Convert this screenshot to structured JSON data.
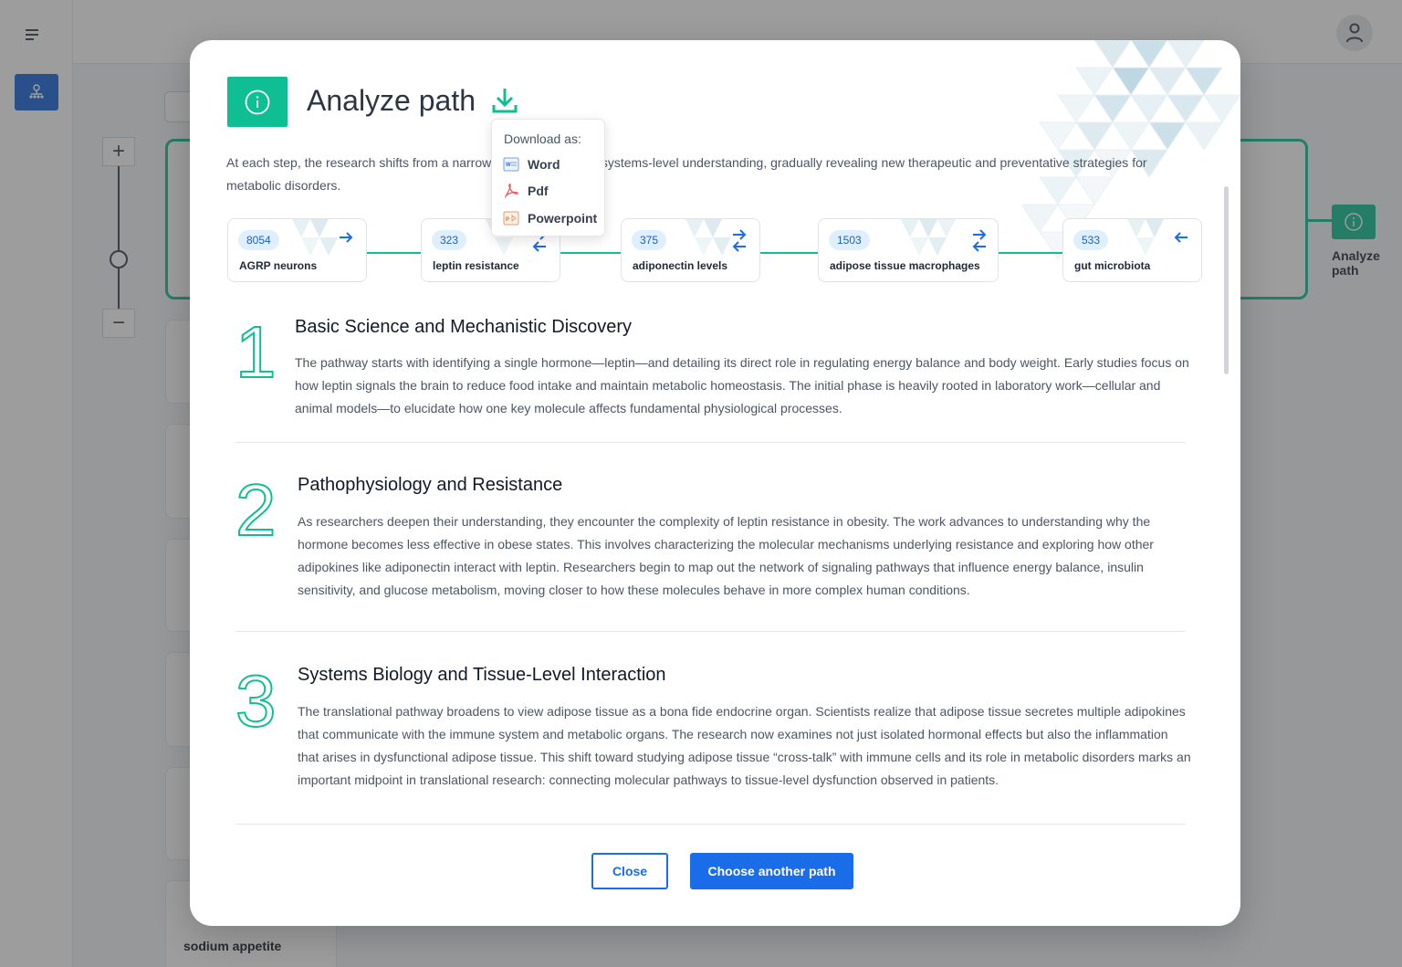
{
  "modal": {
    "title": "Analyze path",
    "intro": "At each step, the research shifts from a narrow focus to a broader systems-level understanding, gradually revealing new therapeutic and preventative strategies for metabolic disorders.",
    "download_menu": {
      "title": "Download as:",
      "items": [
        {
          "label": "Word",
          "icon": "word-doc-icon"
        },
        {
          "label": "Pdf",
          "icon": "pdf-icon"
        },
        {
          "label": "Powerpoint",
          "icon": "powerpoint-icon"
        }
      ]
    },
    "path": [
      {
        "count": "8054",
        "label": "AGRP neurons",
        "arrow": "right"
      },
      {
        "count": "323",
        "label": "leptin resistance",
        "arrow": "both"
      },
      {
        "count": "375",
        "label": "adiponectin levels",
        "arrow": "both"
      },
      {
        "count": "1503",
        "label": "adipose tissue macrophages",
        "arrow": "both"
      },
      {
        "count": "533",
        "label": "gut microbiota",
        "arrow": "left"
      }
    ],
    "sections": [
      {
        "number": "1",
        "title": "Basic Science and Mechanistic Discovery",
        "body": "The pathway starts with identifying a single hormone—leptin—and detailing its direct role in regulating energy balance and body weight. Early studies focus on how leptin signals the brain to reduce food intake and maintain metabolic homeostasis. The initial phase is heavily rooted in laboratory work—cellular and animal models—to elucidate how one key molecule affects fundamental physiological processes."
      },
      {
        "number": "2",
        "title": "Pathophysiology and Resistance",
        "body": "As researchers deepen their understanding, they encounter the complexity of leptin resistance in obesity. The work advances to understanding why the hormone becomes less effective in obese states. This involves characterizing the molecular mechanisms underlying resistance and exploring how other adipokines like adiponectin interact with leptin. Researchers begin to map out the network of signaling pathways that influence energy balance, insulin sensitivity, and glucose metabolism, moving closer to how these molecules behave in more complex human conditions."
      },
      {
        "number": "3",
        "title": "Systems Biology and Tissue-Level Interaction",
        "body": "The translational pathway broadens to view adipose tissue as a bona fide endocrine organ. Scientists realize that adipose tissue secretes multiple adipokines that communicate with the immune system and metabolic organs. The research now examines not just isolated hormonal effects but also the inflammation that arises in dysfunctional adipose tissue. This shift toward studying adipose tissue “cross-talk” with immune cells and its role in metabolic disorders marks an important midpoint in translational research: connecting molecular pathways to tissue-level dysfunction observed in patients."
      }
    ],
    "buttons": {
      "close": "Close",
      "choose": "Choose another path"
    }
  },
  "background": {
    "side_label": "Analyze path",
    "bottom_node": "sodium appetite"
  },
  "colors": {
    "accent_green": "#0fbf93",
    "primary_blue": "#1a6ce8"
  }
}
